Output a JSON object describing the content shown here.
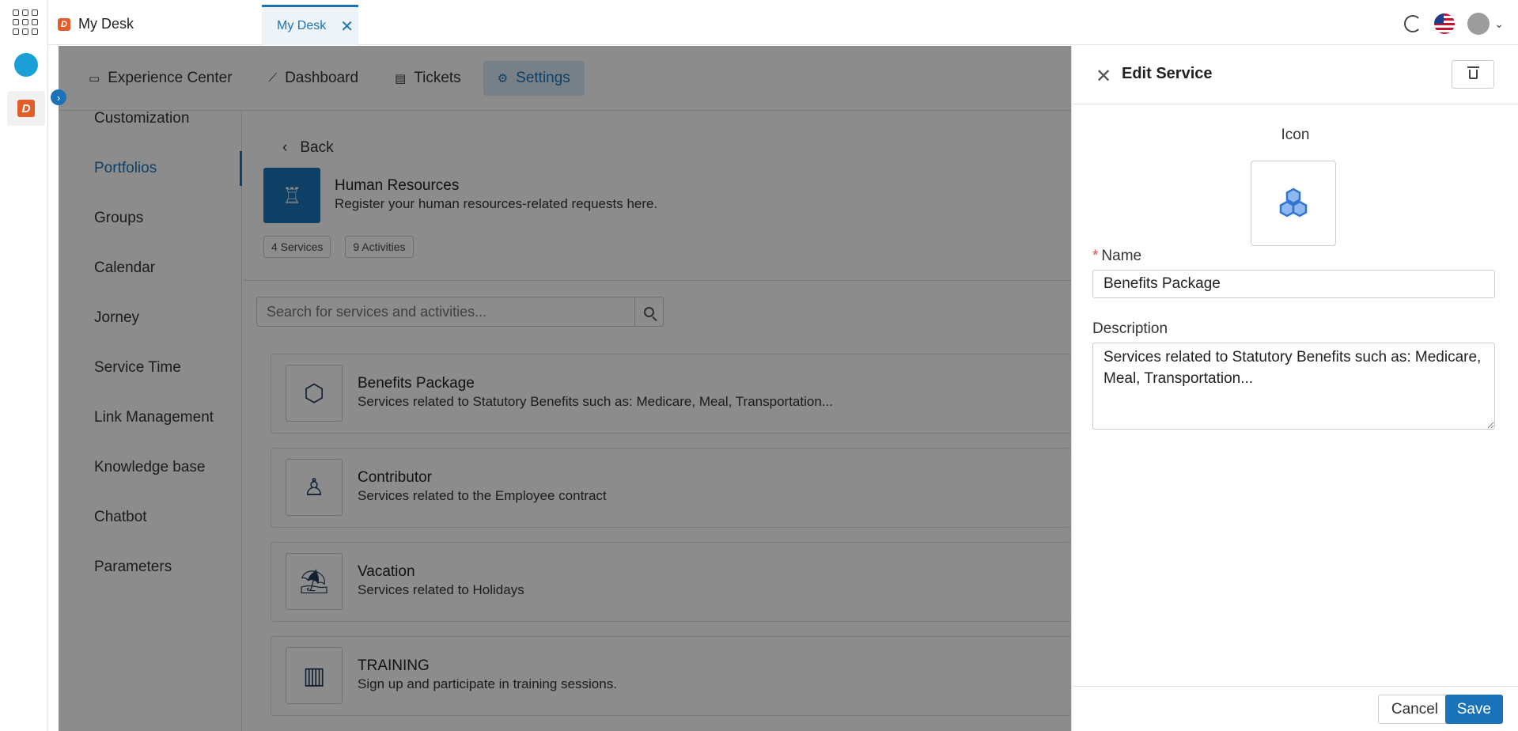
{
  "app": {
    "title": "My Desk",
    "open_tab": "My Desk"
  },
  "topbar": {
    "icons": [
      "apps-grid-icon",
      "refresh-icon",
      "us-flag-icon",
      "user-avatar-icon"
    ]
  },
  "nav_tabs": [
    {
      "label": "Experience Center",
      "icon": "monitor-icon"
    },
    {
      "label": "Dashboard",
      "icon": "chart-icon"
    },
    {
      "label": "Tickets",
      "icon": "ticket-icon"
    },
    {
      "label": "Settings",
      "icon": "gear-icon",
      "active": true
    }
  ],
  "side_menu": [
    "Customization",
    "Portfolios",
    "Groups",
    "Calendar",
    "Jorney",
    "Service Time",
    "Link Management",
    "Knowledge base",
    "Chatbot",
    "Parameters"
  ],
  "portfolio": {
    "back_label": "Back",
    "title": "Human Resources",
    "description": "Register your human resources-related requests here.",
    "badges": [
      "4 Services",
      "9 Activities"
    ],
    "search_placeholder": "Search for services and activities..."
  },
  "services": [
    {
      "title": "Benefits Package",
      "description": "Services related to Statutory Benefits such as: Medicare, Meal, Transportation...",
      "icon": "hexagons-icon"
    },
    {
      "title": "Contributor",
      "description": "Services related to the Employee contract",
      "icon": "person-icon"
    },
    {
      "title": "Vacation",
      "description": "Services related to Holidays",
      "icon": "beach-icon"
    },
    {
      "title": "TRAINING",
      "description": "Sign up and participate in training sessions.",
      "icon": "books-icon"
    }
  ],
  "drawer": {
    "title": "Edit Service",
    "icon_label": "Icon",
    "name_label": "Name",
    "name_value": "Benefits Package",
    "description_label": "Description",
    "description_value": "Services related to Statutory Benefits such as: Medicare, Meal, Transportation...",
    "cancel_label": "Cancel",
    "save_label": "Save"
  },
  "colors": {
    "accent": "#1a73b8",
    "brand": "#e35d2a",
    "required": "#e24b4b"
  }
}
